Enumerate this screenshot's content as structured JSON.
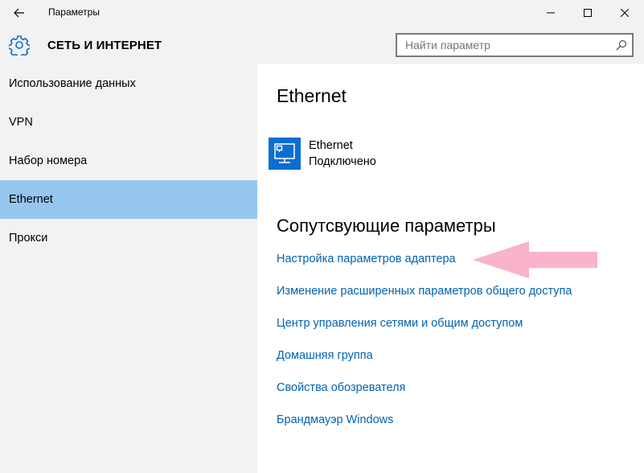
{
  "window": {
    "title": "Параметры"
  },
  "header": {
    "title": "СЕТЬ И ИНТЕРНЕТ",
    "search_placeholder": "Найти параметр"
  },
  "sidebar": {
    "items": [
      {
        "label": "Использование данных",
        "active": false
      },
      {
        "label": "VPN",
        "active": false
      },
      {
        "label": "Набор номера",
        "active": false
      },
      {
        "label": "Ethernet",
        "active": true
      },
      {
        "label": "Прокси",
        "active": false
      }
    ]
  },
  "main": {
    "heading": "Ethernet",
    "connection": {
      "name": "Ethernet",
      "status": "Подключено"
    },
    "related_heading": "Сопутсвующие параметры",
    "links": [
      "Настройка параметров адаптера",
      "Изменение расширенных параметров общего доступа",
      "Центр управления сетями и общим доступом",
      "Домашняя группа",
      "Свойства обозревателя",
      "Брандмауэр Windows"
    ]
  },
  "colors": {
    "sidebar_bg": "#f2f2f2",
    "active_item": "#95c6ef",
    "link": "#0063b1",
    "accent": "#0a6ed1",
    "annotation_arrow": "#f9b3cc"
  },
  "icons": {
    "back": "back-arrow-icon",
    "gear": "gear-icon",
    "search": "search-icon",
    "ethernet": "ethernet-monitor-icon"
  }
}
